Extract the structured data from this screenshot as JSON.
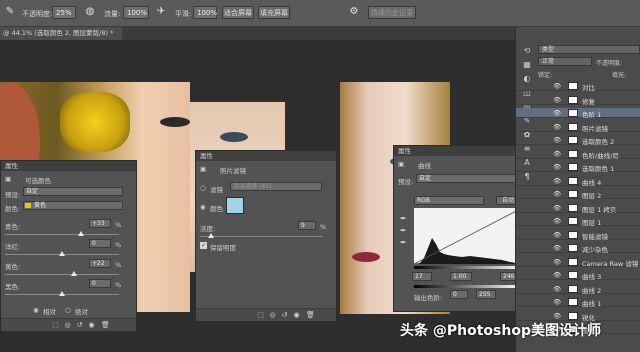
{
  "options_bar": {
    "opacity_label": "不透明度:",
    "opacity_value": "25%",
    "flow_label": "流量:",
    "flow_value": "100%",
    "smoothing_label": "平滑:",
    "smoothing_value": "100%",
    "fill_screen_button": "适合屏幕",
    "fill_screen2_button": "填充屏幕",
    "history_button": "持续历史记录"
  },
  "document_tab": {
    "title": "@ 44.1% (选取颜色 2, 图层蒙版/8) *"
  },
  "selective_color_panel": {
    "title": "属性",
    "header": "可选颜色",
    "preset_label": "预设:",
    "preset_value": "自定",
    "colors_label": "颜色:",
    "colors_value": "黄色",
    "rows": [
      {
        "label": "青色:",
        "value": "+33",
        "unit": "%"
      },
      {
        "label": "洋红:",
        "value": "0",
        "unit": "%"
      },
      {
        "label": "黄色:",
        "value": "+22",
        "unit": "%"
      },
      {
        "label": "黑色:",
        "value": "0",
        "unit": "%"
      }
    ],
    "relative_label": "相对",
    "absolute_label": "绝对"
  },
  "photo_filter_panel": {
    "title": "属性",
    "header": "照片滤镜",
    "filter_label": "滤镜",
    "filter_value": "加温滤镜 (85)",
    "color_label": "颜色",
    "color_swatch": "#9fd3e6",
    "density_label": "浓度:",
    "density_value": "9",
    "density_unit": "%",
    "preserve_label": "保留明度"
  },
  "curves_panel": {
    "title": "属性",
    "header": "曲线",
    "preset_label": "预设:",
    "preset_value": "自定",
    "channel_value": "RGB",
    "auto_button": "自动",
    "input_black": "17",
    "input_gamma": "1.00",
    "input_white": "246",
    "output_label": "输出色阶:",
    "output_black": "0",
    "output_white": "255"
  },
  "layers_panel": {
    "kind_label": "类型",
    "mode_value": "正常",
    "opacity_label": "不透明度:",
    "lock_label": "锁定:",
    "fill_label": "填充:",
    "layers": [
      {
        "name": "对比"
      },
      {
        "name": "修复"
      },
      {
        "name": "色阶 1"
      },
      {
        "name": "照片滤镜"
      },
      {
        "name": "选取颜色 2"
      },
      {
        "name": "色阶/曲线/尼"
      },
      {
        "name": "选取颜色 1"
      },
      {
        "name": "曲线 4"
      },
      {
        "name": "图层 2"
      },
      {
        "name": "图层 1 拷贝"
      },
      {
        "name": "图层 1"
      },
      {
        "name": "智能滤镜"
      },
      {
        "name": "减少杂色"
      },
      {
        "name": "Camera Raw 滤镜"
      },
      {
        "name": "曲线 3"
      },
      {
        "name": "曲线 2"
      },
      {
        "name": "曲线 1"
      },
      {
        "name": "锐化"
      },
      {
        "name": "图层 0"
      }
    ]
  },
  "watermark": "头条 @Photoshop美图设计师"
}
